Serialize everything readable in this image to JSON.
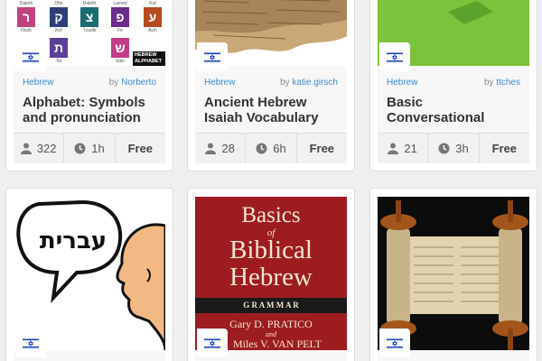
{
  "cards": [
    {
      "language": "Hebrew",
      "by_prefix": "by",
      "author": "Norberto",
      "title": "Alphabet: Symbols and pronunciation",
      "learners": "322",
      "time": "1h",
      "price": "Free",
      "thumb_letters": [
        "ר",
        "ק",
        "צ",
        "פ",
        "ע",
        "ת",
        "ש"
      ],
      "thumb_names": [
        "Daleth",
        "Dhe",
        "Daleth",
        "Lamed",
        "Kaf",
        "Resh",
        "Kof",
        "Tzadik",
        "Fe",
        "Ayin",
        "Tet",
        "Shin"
      ],
      "thumb_caption_1": "HEBREW",
      "thumb_caption_2": "ALPHABET"
    },
    {
      "language": "Hebrew",
      "by_prefix": "by",
      "author": "katie.girsch",
      "title": "Ancient Hebrew Isaiah Vocabulary",
      "learners": "28",
      "time": "6h",
      "price": "Free"
    },
    {
      "language": "Hebrew",
      "by_prefix": "by",
      "author": "ttches",
      "title": "Basic Conversational",
      "learners": "21",
      "time": "3h",
      "price": "Free"
    },
    {
      "speech_text": "עברית"
    },
    {
      "book_line1": "Basics",
      "book_of": "of",
      "book_line2": "Biblical",
      "book_line3": "Hebrew",
      "book_grammar": "G R A M M A R",
      "book_author1": "Gary D. PRATICO",
      "book_and": "and",
      "book_author2": "Miles V. VAN PELT"
    },
    {}
  ],
  "colors": {
    "link": "#3a8bd0",
    "green": "#7cc23a",
    "book_red": "#9d1c20"
  }
}
